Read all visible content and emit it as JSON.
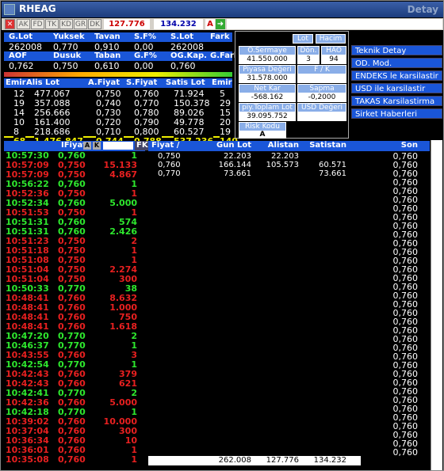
{
  "title": "RHEAG",
  "title_right": "Detay",
  "toolbar": {
    "buttons": [
      "AK",
      "FD",
      "TK",
      "KD",
      "GR",
      "DK"
    ],
    "v1": "127.776",
    "v2": "134.232",
    "a": "A"
  },
  "summary": {
    "h1": [
      "G.Lot",
      "Yuksek",
      "Tavan",
      "S.F%",
      "S.Lot",
      "Fark"
    ],
    "v1": [
      "262008",
      "0,770",
      "0,910",
      "0,00",
      "262008",
      ""
    ],
    "h2": [
      "AOF",
      "Dusuk",
      "Taban",
      "G.F%",
      "OG.Kap.",
      "G.Fark"
    ],
    "v2": [
      "0,762",
      "0,750",
      "0,610",
      "0,00",
      "0,760",
      ""
    ]
  },
  "panel": {
    "lot": "Lot",
    "hacim": "Hacim",
    "osermaye": "O.Sermaye",
    "osermaye_v": "41.550.000",
    "don": "Dön.",
    "don_v": "3",
    "hao": "HAO",
    "hao_v": "94",
    "piyasa": "Piyasa Değeri",
    "piyasa_v": "31.578.000",
    "fk": "F / K",
    "netkar": "Net Kar",
    "netkar_v": "-568.162",
    "sapma": "Sapma",
    "sapma_v": "-0,2000",
    "piy": "piy.Toplam Lot",
    "piy_v": "39.095.752",
    "usd": "USD Değeri",
    "risk": "Risk Kodu",
    "risk_v": "A"
  },
  "menu": [
    "Teknik Detay",
    "OD. Mod.",
    "ENDEKS le karsilastir",
    "USD ile karsilastir",
    "TAKAS Karsilastirma",
    "Sirket Haberleri"
  ],
  "depth": {
    "headers": [
      "Emir",
      "Alis Lot",
      "A.Fiyat",
      "S.Fiyat",
      "Satis Lot",
      "Emir"
    ],
    "rows": [
      [
        "12",
        "477.067",
        "0,750",
        "0,760",
        "71.924",
        "5"
      ],
      [
        "19",
        "357.088",
        "0,740",
        "0,770",
        "150.378",
        "29"
      ],
      [
        "14",
        "256.666",
        "0,730",
        "0,780",
        "89.026",
        "15"
      ],
      [
        "10",
        "161.400",
        "0,720",
        "0,790",
        "49.778",
        "20"
      ],
      [
        "8",
        "218.686",
        "0,710",
        "0,800",
        "60.527",
        "19"
      ]
    ],
    "total": [
      "68",
      "1.476.847",
      "0,744",
      "0,788",
      "537.236",
      "140"
    ]
  },
  "trades": {
    "headers": [
      "IFiyat",
      "A",
      "K",
      "FK"
    ],
    "rows": [
      [
        "10:57:30",
        "0,760",
        "1",
        "g"
      ],
      [
        "10:57:09",
        "0,750",
        "15.133",
        "r"
      ],
      [
        "10:57:09",
        "0,750",
        "4.867",
        "r"
      ],
      [
        "10:56:22",
        "0,760",
        "1",
        "g"
      ],
      [
        "10:52:36",
        "0,750",
        "1",
        "r"
      ],
      [
        "10:52:34",
        "0,760",
        "5.000",
        "g"
      ],
      [
        "10:51:53",
        "0,750",
        "1",
        "r"
      ],
      [
        "10:51:31",
        "0,760",
        "574",
        "g"
      ],
      [
        "10:51:31",
        "0,760",
        "2.426",
        "g"
      ],
      [
        "10:51:23",
        "0,750",
        "2",
        "r"
      ],
      [
        "10:51:18",
        "0,750",
        "1",
        "r"
      ],
      [
        "10:51:08",
        "0,750",
        "1",
        "r"
      ],
      [
        "10:51:04",
        "0,750",
        "2.274",
        "r"
      ],
      [
        "10:51:04",
        "0,750",
        "300",
        "r"
      ],
      [
        "10:50:33",
        "0,770",
        "38",
        "g"
      ],
      [
        "10:48:41",
        "0,760",
        "8.632",
        "r"
      ],
      [
        "10:48:41",
        "0,760",
        "1.000",
        "r"
      ],
      [
        "10:48:41",
        "0,760",
        "750",
        "r"
      ],
      [
        "10:48:41",
        "0,760",
        "1.618",
        "r"
      ],
      [
        "10:47:20",
        "0,770",
        "2",
        "g"
      ],
      [
        "10:46:37",
        "0,770",
        "1",
        "g"
      ],
      [
        "10:43:55",
        "0,760",
        "3",
        "r"
      ],
      [
        "10:42:54",
        "0,770",
        "1",
        "g"
      ],
      [
        "10:42:43",
        "0,760",
        "379",
        "r"
      ],
      [
        "10:42:43",
        "0,760",
        "621",
        "r"
      ],
      [
        "10:42:41",
        "0,770",
        "2",
        "g"
      ],
      [
        "10:42:36",
        "0,760",
        "5.000",
        "r"
      ],
      [
        "10:42:18",
        "0,770",
        "1",
        "g"
      ],
      [
        "10:39:02",
        "0,760",
        "10.000",
        "r"
      ],
      [
        "10:37:04",
        "0,760",
        "300",
        "r"
      ],
      [
        "10:36:34",
        "0,760",
        "10",
        "r"
      ],
      [
        "10:36:01",
        "0,760",
        "1",
        "r"
      ],
      [
        "10:35:08",
        "0,760",
        "1",
        "r"
      ]
    ]
  },
  "ob": {
    "headers": [
      "Fiyat /",
      "Gun Lot",
      "Alistan",
      "Satistan",
      "Son"
    ],
    "rows": [
      [
        "0,750",
        "22.203",
        "22.203",
        "",
        ""
      ],
      [
        "0,760",
        "166.144",
        "105.573",
        "60.571",
        ""
      ],
      [
        "0,770",
        "73.661",
        "",
        "73.661",
        ""
      ]
    ],
    "son": "0,760",
    "total": [
      "262.008",
      "127.776",
      "134.232",
      "-"
    ]
  }
}
